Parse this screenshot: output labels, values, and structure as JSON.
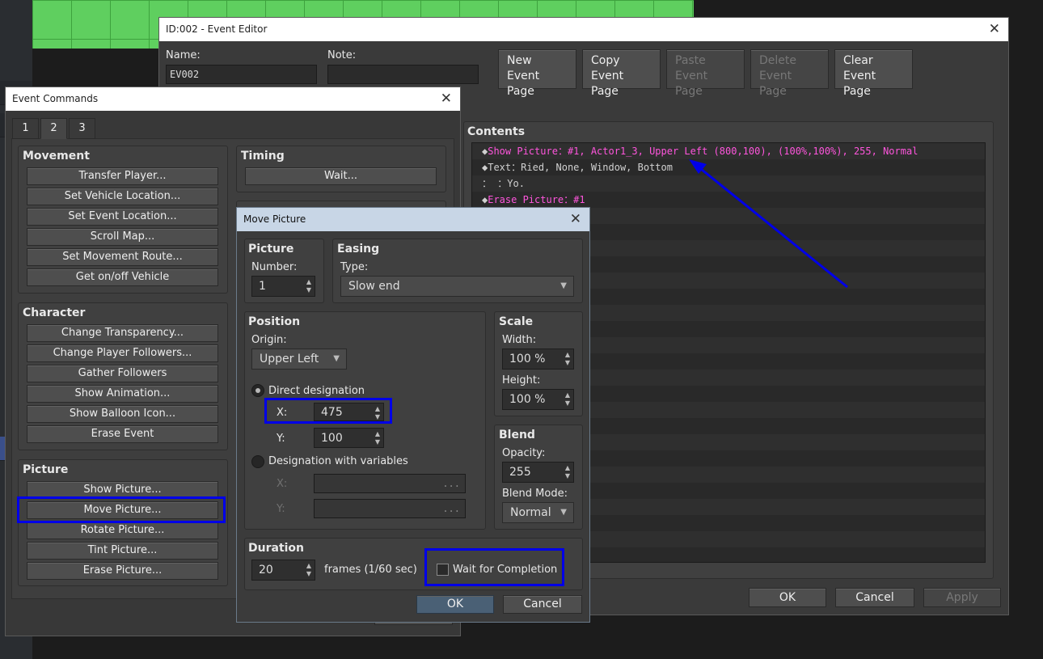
{
  "event_editor": {
    "title": "ID:002 - Event Editor",
    "name_label": "Name:",
    "name_value": "EV002",
    "note_label": "Note:",
    "note_value": "",
    "buttons": [
      "New\nEvent Page",
      "Copy\nEvent Page",
      "Paste\nEvent Page",
      "Delete\nEvent Page",
      "Clear\nEvent Page"
    ],
    "contents_label": "Contents",
    "contents": [
      {
        "marker": "◆",
        "cmd": "Show Picture",
        "args": "：#1, Actor1_3, Upper Left (800,100), (100%,100%), 255, Normal",
        "color": "#ff55dd"
      },
      {
        "marker": "◆",
        "cmd": "Text",
        "args": "：Ried, None, Window, Bottom",
        "color": "#d0d0d0"
      },
      {
        "marker": "：",
        "cmd": "",
        "args": "    ：Yo.",
        "color": "#d0d0d0"
      },
      {
        "marker": "◆",
        "cmd": "Erase Picture",
        "args": "：#1",
        "color": "#ff55dd"
      }
    ],
    "ok": "OK",
    "cancel": "Cancel",
    "apply": "Apply"
  },
  "event_commands": {
    "title": "Event Commands",
    "tabs": [
      "1",
      "2",
      "3"
    ],
    "movement": {
      "header": "Movement",
      "items": [
        "Transfer Player...",
        "Set Vehicle Location...",
        "Set Event Location...",
        "Scroll Map...",
        "Set Movement Route...",
        "Get on/off Vehicle"
      ]
    },
    "character": {
      "header": "Character",
      "items": [
        "Change Transparency...",
        "Change Player Followers...",
        "Gather Followers",
        "Show Animation...",
        "Show Balloon Icon...",
        "Erase Event"
      ]
    },
    "picture": {
      "header": "Picture",
      "items": [
        "Show Picture...",
        "Move Picture...",
        "Rotate Picture...",
        "Tint Picture...",
        "Erase Picture..."
      ]
    },
    "timing": {
      "header": "Timing",
      "items": [
        "Wait..."
      ]
    }
  },
  "move_picture": {
    "title": "Move Picture",
    "picture_header": "Picture",
    "number_label": "Number:",
    "number_value": "1",
    "easing_header": "Easing",
    "type_label": "Type:",
    "type_value": "Slow end",
    "position_header": "Position",
    "origin_label": "Origin:",
    "origin_value": "Upper Left",
    "direct_label": "Direct designation",
    "x_label": "X:",
    "x_value": "475",
    "y_label": "Y:",
    "y_value": "100",
    "variables_label": "Designation with variables",
    "var_x_label": "X:",
    "var_y_label": "Y:",
    "var_dots": "...",
    "scale_header": "Scale",
    "width_label": "Width:",
    "width_value": "100 %",
    "height_label": "Height:",
    "height_value": "100 %",
    "blend_header": "Blend",
    "opacity_label": "Opacity:",
    "opacity_value": "255",
    "blend_mode_label": "Blend Mode:",
    "blend_mode_value": "Normal",
    "duration_header": "Duration",
    "duration_value": "20",
    "frames_label": "frames (1/60 sec)",
    "wait_label": "Wait for Completion",
    "wait_checked": false,
    "ok": "OK",
    "cancel": "Cancel"
  },
  "annotation_color": "#0000e8"
}
